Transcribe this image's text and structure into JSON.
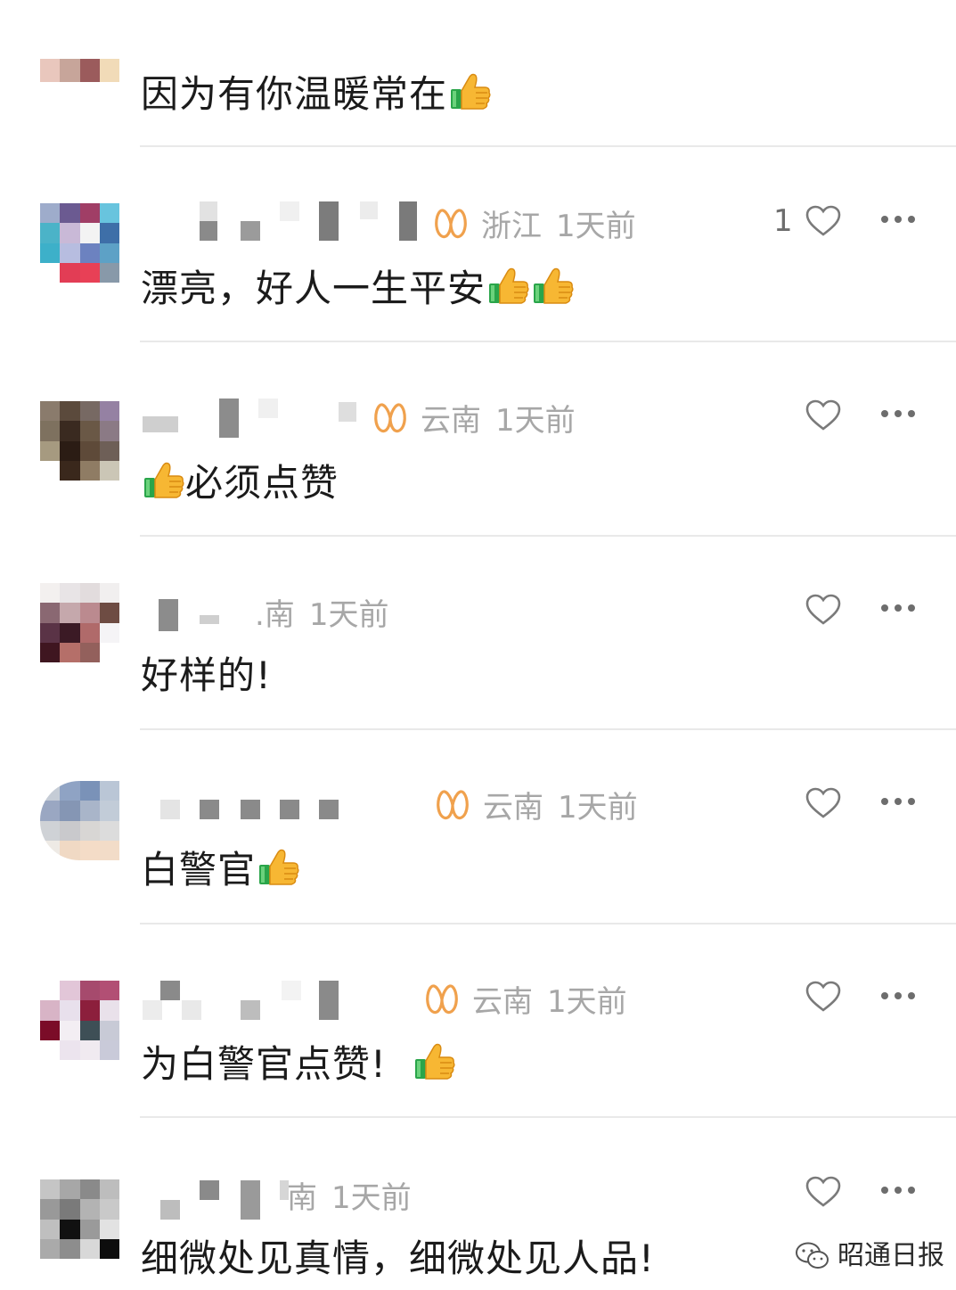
{
  "comments": [
    {
      "text": "因为有你温暖常在",
      "thumbs": 1
    },
    {
      "badge": "ꕤ",
      "location": "浙江",
      "time": "1天前",
      "likes": "1",
      "text": "漂亮，好人一生平安",
      "thumbs": 2
    },
    {
      "badge": "ꕤ",
      "location": "云南",
      "time": "1天前",
      "likes": "",
      "text": "必须点赞",
      "thumbs_prefix": 1
    },
    {
      "location_partial": ".南",
      "time": "1天前",
      "likes": "",
      "text": "好样的!"
    },
    {
      "badge": "ꕤ",
      "location": "云南",
      "time": "1天前",
      "likes": "",
      "text": "白警官",
      "thumbs": 1
    },
    {
      "badge": "ꕤ",
      "location": "云南",
      "time": "1天前",
      "likes": "",
      "text": "为白警官点赞!",
      "thumbs": 1
    },
    {
      "location_partial": "南",
      "time": "1天前",
      "likes": "",
      "text": "细微处见真情，细微处见人品!"
    }
  ],
  "watermark": "昭通日报",
  "colors": {
    "badge": "#f0a14d",
    "meta": "#a7a7a7",
    "divider": "#e9e9e9",
    "text": "#1b1b1b"
  },
  "icons": {
    "like": "heart-icon",
    "more": "more-icon",
    "thumbs": "thumbs-up-emoji"
  }
}
